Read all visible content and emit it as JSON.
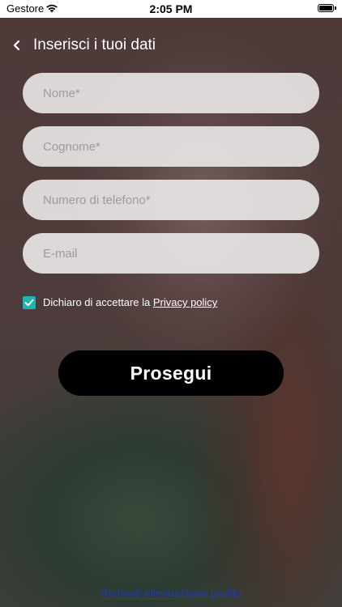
{
  "status_bar": {
    "carrier": "Gestore",
    "time": "2:05 PM",
    "icons": [
      "wifi-icon",
      "battery-icon"
    ]
  },
  "header": {
    "back_icon": "chevron-left-icon",
    "title": "Inserisci i tuoi dati"
  },
  "form": {
    "fields": [
      {
        "name": "first-name",
        "placeholder": "Nome*",
        "value": ""
      },
      {
        "name": "last-name",
        "placeholder": "Cognome*",
        "value": ""
      },
      {
        "name": "phone",
        "placeholder": "Numero di telefono*",
        "value": ""
      },
      {
        "name": "email",
        "placeholder": "E-mail",
        "value": ""
      }
    ],
    "consent": {
      "checked": true,
      "text": "Dichiaro di accettare la ",
      "link": "Privacy policy"
    },
    "submit_label": "Prosegui"
  },
  "footer": {
    "delete_link": "Richiedi eliminazione profilo"
  },
  "colors": {
    "checkbox": "#1fb6b2",
    "button": "#000000",
    "link": "#1d3ac0",
    "field_bg": "#ece9e9"
  }
}
